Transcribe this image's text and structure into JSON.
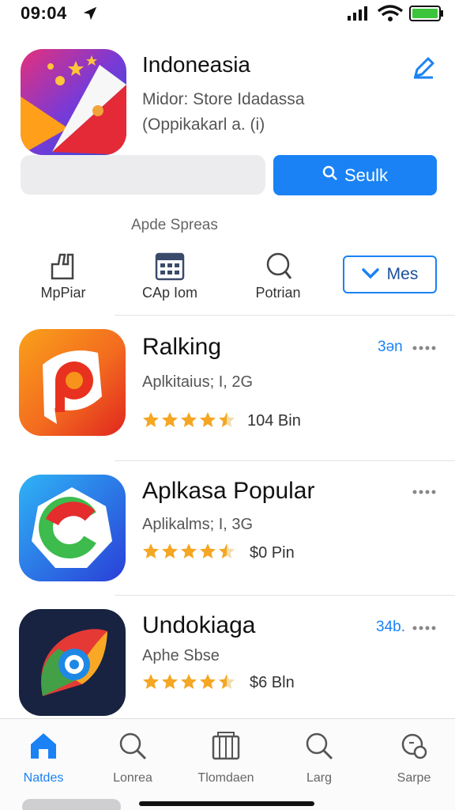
{
  "status": {
    "time": "09:04"
  },
  "hero": {
    "title": "Indoneasia",
    "subtitle": "Midor: Store Idadassa",
    "meta": "(Oppikakarl a. (i)"
  },
  "search": {
    "placeholder": "",
    "button_label": "Seulk"
  },
  "section_label": "Apde Spreas",
  "categories": [
    {
      "label": "MpPiar",
      "icon": "hand-icon"
    },
    {
      "label": "CAp Iom",
      "icon": "calendar-icon"
    },
    {
      "label": "Potrian",
      "icon": "search-icon"
    }
  ],
  "more_button": {
    "label": "Mes"
  },
  "apps": [
    {
      "title": "Ralking",
      "subtitle": "Aplkitaius; I, 2G",
      "rating": 4.5,
      "count": "104 Bin",
      "rank": "3ən",
      "icon": "app-icon-ralking",
      "colors": [
        "#f36b1f",
        "#e0261f",
        "#f9a11a"
      ]
    },
    {
      "title": "Aplkasa Popular",
      "subtitle": "Aplikalms; I, 3G",
      "rating": 4.5,
      "count": "$0 Pin",
      "rank": "",
      "icon": "app-icon-popular",
      "colors": [
        "#1a6af3",
        "#e52d2d",
        "#3dbb4d"
      ]
    },
    {
      "title": "Undokiaga",
      "subtitle": "Aphe Sbse",
      "rating": 4.5,
      "count": "$6 Bln",
      "rank": "34b.",
      "icon": "app-icon-undokiaga",
      "colors": [
        "#172340",
        "#e53935",
        "#43a047"
      ]
    }
  ],
  "tabs": [
    {
      "label": "Natdes",
      "icon": "home-icon",
      "active": true
    },
    {
      "label": "Lonrea",
      "icon": "search-icon",
      "active": false
    },
    {
      "label": "Tlomdaen",
      "icon": "apps-icon",
      "active": false
    },
    {
      "label": "Larg",
      "icon": "search-icon",
      "active": false
    },
    {
      "label": "Sarpe",
      "icon": "profile-icon",
      "active": false
    }
  ],
  "accent_color": "#1a82f5"
}
